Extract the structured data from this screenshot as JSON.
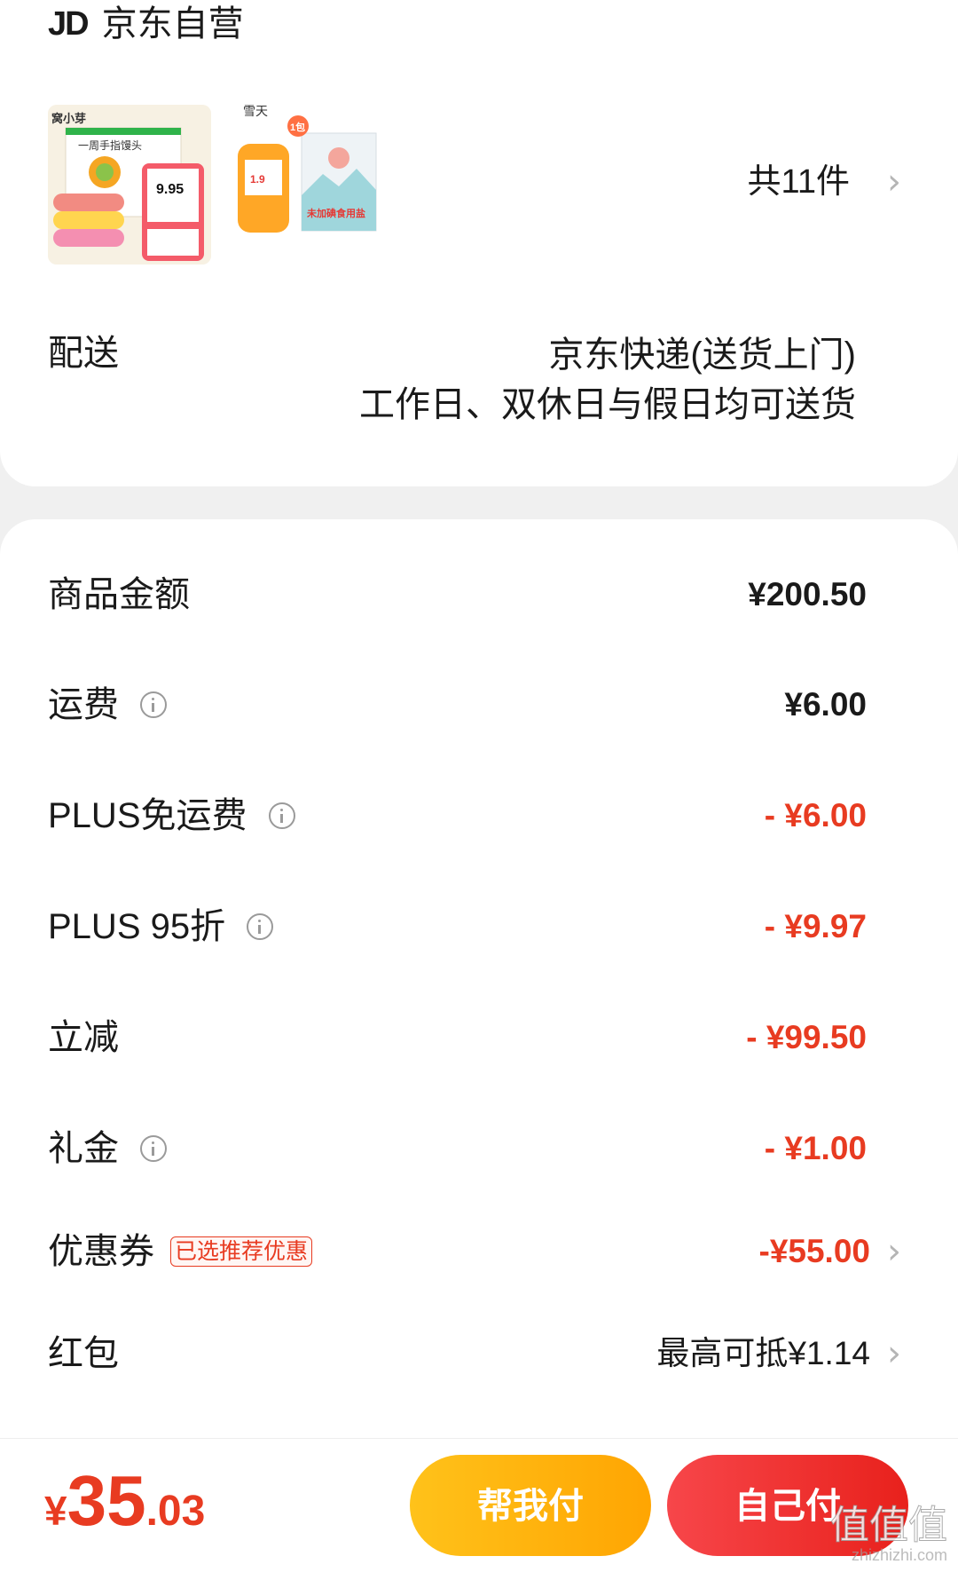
{
  "shop": {
    "logo": "JD",
    "name": "京东自营"
  },
  "order": {
    "item_count": "共11件",
    "products": [
      {
        "brand": "窝小芽",
        "title": "一周手指馒头",
        "price": "9.95"
      },
      {
        "brand": "雪天",
        "title": "未加碘食用盐",
        "price": "1.9",
        "badge": "1包"
      }
    ]
  },
  "delivery": {
    "label": "配送",
    "line1": "京东快递(送货上门)",
    "line2": "工作日、双休日与假日均可送货"
  },
  "summary": {
    "rows": [
      {
        "label": "商品金额",
        "value": "¥200.50"
      },
      {
        "label": "运费",
        "value": "¥6.00"
      },
      {
        "label": "PLUS免运费",
        "value": "- ¥6.00"
      },
      {
        "label": "PLUS 95折",
        "value": "- ¥9.97"
      },
      {
        "label": "立减",
        "value": "- ¥99.50"
      },
      {
        "label": "礼金",
        "value": "- ¥1.00"
      },
      {
        "label": "优惠券",
        "badge": "已选推荐优惠",
        "value": "-¥55.00"
      },
      {
        "label": "红包",
        "value": "最高可抵¥1.14"
      }
    ]
  },
  "footer": {
    "currency": "¥",
    "total_int": "35",
    "total_dec": ".03",
    "help_pay_label": "帮我付",
    "self_pay_label": "自己付"
  },
  "watermark": {
    "text": "值值值",
    "url": "zhizhizhi.com"
  },
  "colors": {
    "accent_red": "#e83b21",
    "help_button": "#ffb40e",
    "self_button": "#f0302c"
  }
}
